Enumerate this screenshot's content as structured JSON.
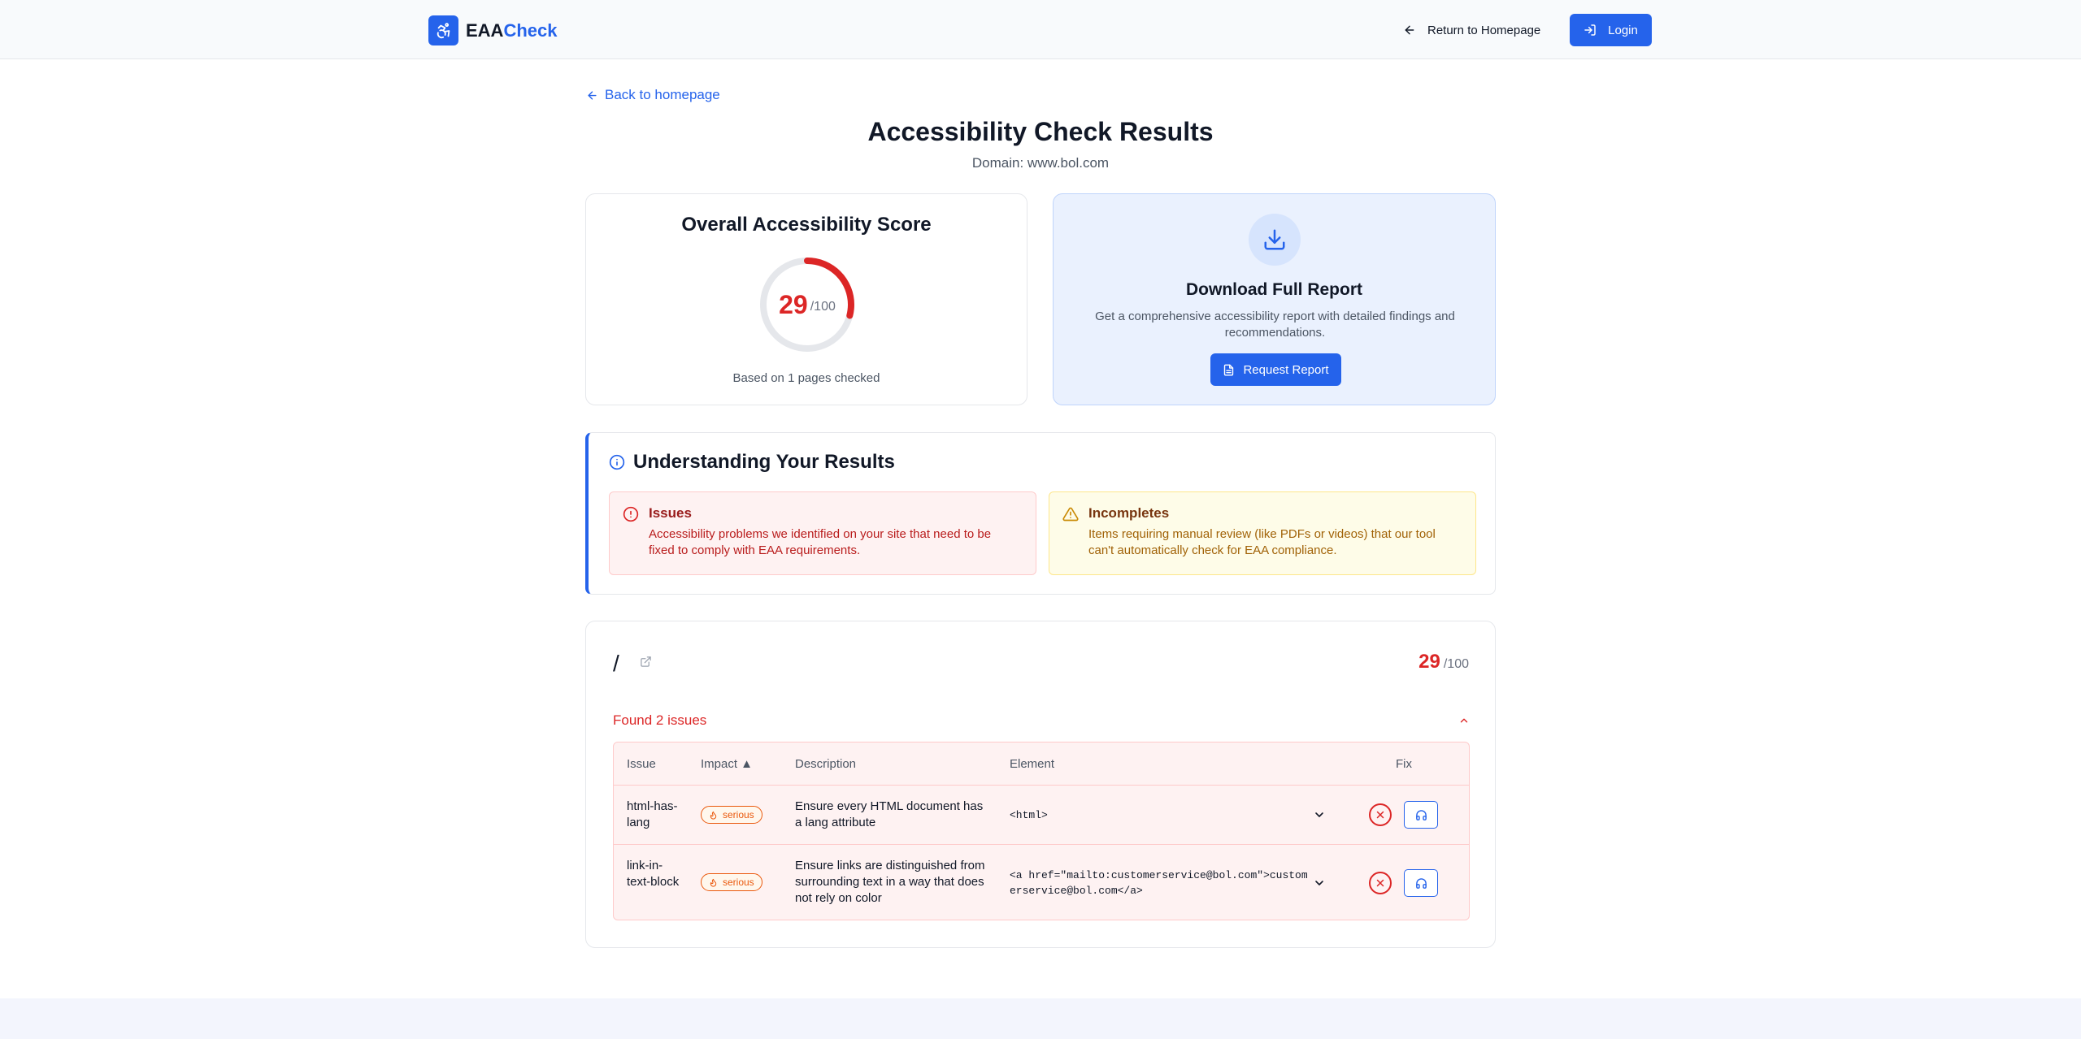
{
  "header": {
    "logo_part1": "EAA",
    "logo_part2": "Check",
    "return_label": "Return to Homepage",
    "login_label": "Login"
  },
  "main": {
    "back_label": "Back to homepage",
    "title": "Accessibility Check Results",
    "domain_line": "Domain: www.bol.com"
  },
  "score_card": {
    "title": "Overall Accessibility Score",
    "score": "29",
    "max": "/100",
    "score_fraction": 0.29,
    "based_on": "Based on 1 pages checked"
  },
  "download_card": {
    "title": "Download Full Report",
    "description": "Get a comprehensive accessibility report with detailed findings and recommendations.",
    "button_label": "Request Report"
  },
  "understanding": {
    "title": "Understanding Your Results",
    "issues_title": "Issues",
    "issues_text": "Accessibility problems we identified on your site that need to be fixed to comply with EAA requirements.",
    "incompletes_title": "Incompletes",
    "incompletes_text": "Items requiring manual review (like PDFs or videos) that our tool can't automatically check for EAA compliance."
  },
  "page_result": {
    "path": "/",
    "score": "29",
    "max": "/100",
    "found_text": "Found 2 issues",
    "columns": {
      "issue": "Issue",
      "impact": "Impact ▲",
      "description": "Description",
      "element": "Element",
      "fix": "Fix"
    },
    "rows": [
      {
        "issue": "html-has-lang",
        "impact": "serious",
        "description": "Ensure every HTML document has a lang attribute",
        "element": "<html>"
      },
      {
        "issue": "link-in-text-block",
        "impact": "serious",
        "description": "Ensure links are distinguished from surrounding text in a way that does not rely on color",
        "element": "<a href=\"mailto:customerservice@bol.com\">customerservice@bol.com</a>"
      }
    ]
  },
  "colors": {
    "primary": "#2563eb",
    "danger": "#dc2626",
    "warning": "#ea580c"
  }
}
